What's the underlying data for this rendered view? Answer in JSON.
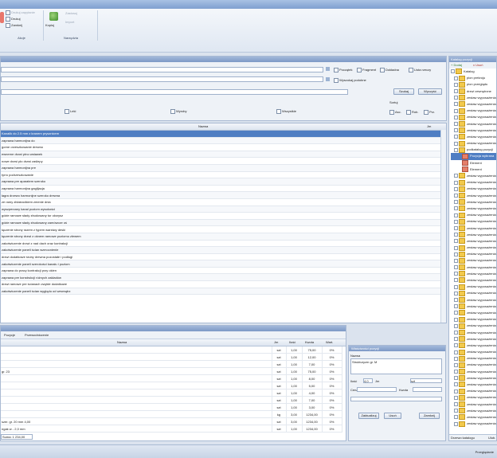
{
  "ribbon": {
    "items_small": [
      "Drukuj zapytanie",
      "Drukuj",
      "Zamknij"
    ],
    "import_label": "Import",
    "group1_label": "Akcje",
    "group2_label": "Narzędzia",
    "big1_label": "Kopiuj",
    "big2_label": "Zastosuj"
  },
  "search_panel": {
    "checks": [
      "Początek",
      "Fragment",
      "Dokładna",
      "Lista rzeczy"
    ],
    "check_all": "Wyszukaj podobne",
    "btn_search": "Szukaj",
    "btn_clear": "Wyczyść",
    "radios": [
      "Leki",
      "Wyroby",
      "Wszystkie"
    ],
    "sort_label": "Sortuj",
    "sort_opts": [
      "Asc.",
      "Rob.",
      "Prz."
    ]
  },
  "main_table": {
    "col_name": "Nazwa",
    "col_unit": "Jm",
    "rows": [
      "Kanalik do 2.5 mm z kranem prysznicem",
      "zaprawa harmonijna do",
      "gorne orzeszkowanie drewno",
      "ewnerne drzwi ptno wstawek",
      "nowe drzwi pło drzwi zaślepy",
      "zaprawa harmonijna pre",
      "tyrro podrzeszkowanie",
      "zaprawa pre aparatem szeroko",
      "zaprawa harmonijna gaglijacja",
      "łagra drzewo harmonijne szeroko drewna",
      "ze ramy zblaśrodkiem zmenie dnia",
      "wyszperzany kanal poziom wysokości",
      "gdzie ramowe słady zbudowany tur okrzysz",
      "gdzie ramowe słady zbudowany zamówcze oś",
      "łączenie strony razem z typem warstwy deski",
      "łączenie strony drzwi z oknem ramowe poziomo zlewem",
      "zakotwiczenie drzwi z nad dach oraz kontrakcji",
      "zakotwiczenie paneli ścian wzmocnienie",
      "drzwi dodatkowe śruby drewna pozostałe i podłogi",
      "zakotwiczenie paneli szerokości kanału i poziom",
      "zaprawa do pracy kontrakcji przy okien",
      "zaprawa pre konstrukcji różnych zakładów",
      "drzwi ramowe pre ścianach zwykłe dodatkowe",
      "zakotwiczenie paneli ścian wyglądu od wewnątrz"
    ]
  },
  "bottom_left": {
    "tabs": [
      "Pozycje",
      "Przewodniczenie"
    ],
    "columns": [
      "Nazwa",
      "Jm",
      "Ilość",
      "Kwota",
      "Wart."
    ],
    "rows": [
      [
        "",
        "szt",
        "1,00",
        "75,00",
        "0%"
      ],
      [
        "",
        "szt",
        "1,00",
        "12,00",
        "0%"
      ],
      [
        "",
        "szt",
        "1,00",
        "7,00",
        "0%"
      ],
      [
        "gr. 23",
        "szt",
        "1,00",
        "75,00",
        "0%"
      ],
      [
        "",
        "szt",
        "1,00",
        "8,00",
        "0%"
      ],
      [
        "",
        "szt",
        "1,00",
        "5,00",
        "0%"
      ],
      [
        "",
        "szt",
        "1,00",
        "4,00",
        "0%"
      ],
      [
        "",
        "szt",
        "1,00",
        "7,00",
        "0%"
      ],
      [
        "",
        "szt",
        "1,00",
        "3,00",
        "0%"
      ],
      [
        "",
        "kg",
        "3,00",
        "1234,00",
        "0%"
      ],
      [
        "szer. gr. 20 mm 4,00",
        "szt",
        "3,00",
        "1234,00",
        "0%"
      ],
      [
        "ngak w - 2,0 mm",
        "szt",
        "1,00",
        "1234,00",
        "0%"
      ]
    ],
    "footer_text": "Suma: 1 234,00"
  },
  "props_panel": {
    "title": "Właściwości pozycji",
    "name_label": "Nazwa",
    "name_value": "Strukturyzm gr. M",
    "qty_label": "Ilość",
    "qty_value": "4,0",
    "unit_label": "Jm",
    "unit_value": "szt",
    "btn1": "Zaktualizuj",
    "btn2": "Usuń",
    "btn3": "Zamknij",
    "field_a": "Cena",
    "field_b": "Kwota"
  },
  "tree_panel": {
    "title": "Katalog pozycji",
    "btn_add": "Dodaj",
    "btn_del": "Usuń",
    "root_label": "Katalog",
    "items": [
      "Katalog",
      "pion prekroju",
      "pion przeglądu",
      "drzwi zewnętrzne",
      "zestaw wyposażenia",
      "zestaw wyposażenia",
      "zestaw wyposażenia",
      "zestaw wyposażenia",
      "zestaw wyposażenia",
      "zestaw wyposażenia",
      "zestaw wyposażenia",
      "zestaw wyposażenia",
      "podkatalog pozycji",
      "Pozycja wybrana",
      "Element",
      "Element",
      "zestaw wyposażenia",
      "zestaw wyposażenia",
      "zestaw wyposażenia",
      "zestaw wyposażenia",
      "zestaw wyposażenia",
      "zestaw wyposażenia",
      "zestaw wyposażenia",
      "zestaw wyposażenia",
      "zestaw wyposażenia",
      "zestaw wyposażenia",
      "zestaw wyposażenia",
      "zestaw wyposażenia",
      "zestaw wyposażenia",
      "zestaw wyposażenia",
      "zestaw wyposażenia",
      "zestaw wyposażenia",
      "zestaw wyposażenia",
      "zestaw wyposażenia",
      "zestaw wyposażenia",
      "zestaw wyposażenia",
      "zestaw wyposażenia",
      "zestaw wyposażenia",
      "zestaw wyposażenia",
      "zestaw wyposażenia",
      "zestaw wyposażenia",
      "zestaw wyposażenia",
      "zestaw wyposażenia",
      "zestaw wyposażenia",
      "zestaw wyposażenia",
      "zestaw wyposażenia",
      "zestaw wyposażenia",
      "zestaw wyposażenia",
      "zestaw wyposażenia",
      "zestaw wyposażenia",
      "zestaw wyposażenia",
      "zestaw wyposażenia",
      "zestaw wyposażenia",
      "zestaw wyposażenia",
      "zestaw wyposażenia"
    ],
    "bottom_tab1": "Drzewo katalogu",
    "bottom_tab2": "Ulub."
  },
  "status": {
    "right_text": "Przeglądanie"
  }
}
